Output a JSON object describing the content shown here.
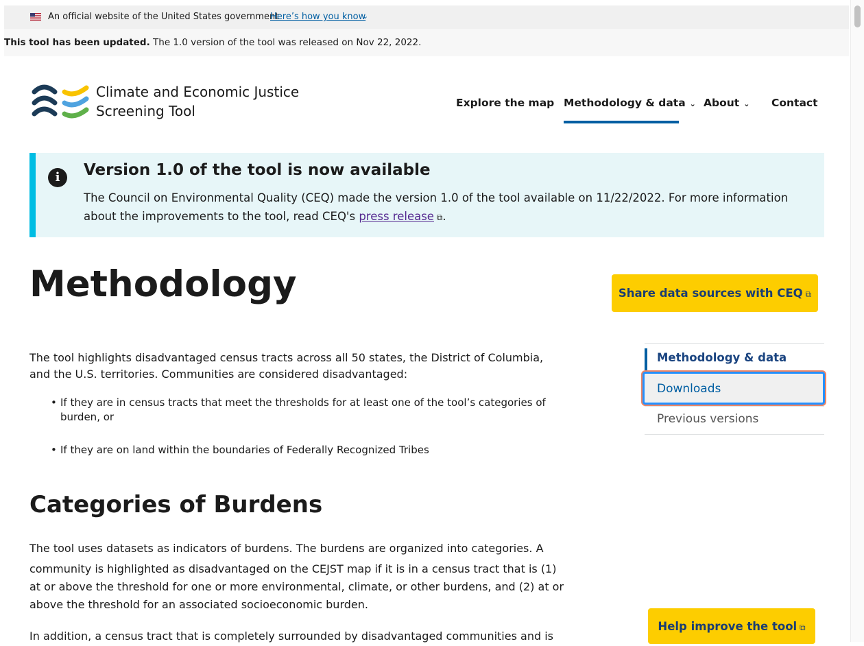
{
  "gov_banner": {
    "text": "An official website of the United States government",
    "link": "Here’s how you know"
  },
  "update_bar": {
    "bold": "This tool has been updated.",
    "text": " The 1.0 version of the tool was released on Nov 22, 2022."
  },
  "header": {
    "title_line1": "Climate and Economic Justice",
    "title_line2": "Screening Tool",
    "nav": {
      "explore": "Explore the map",
      "methodology": "Methodology & data",
      "about": "About",
      "contact": "Contact"
    }
  },
  "alert": {
    "heading": "Version 1.0 of the tool is now available",
    "body_before": "The Council on Environmental Quality (CEQ) made the version 1.0 of the tool available on 11/22/2022. For more information about the improvements to the tool, read CEQ's ",
    "link": "press release",
    "body_after": "."
  },
  "main": {
    "title": "Methodology",
    "intro_line1": "The tool highlights disadvantaged census tracts across all 50 states, the District of Columbia,",
    "intro_line2": "and the U.S. territories. Communities are considered disadvantaged:",
    "bullet1_line1": "If they are in census tracts that meet the thresholds for at least one of the tool’s categories of",
    "bullet1_line2": "burden, or",
    "bullet2": "If they are on land within the boundaries of Federally Recognized Tribes",
    "categories_heading": "Categories of Burdens",
    "cat_p1_l1": "The tool uses datasets as indicators of burdens. The burdens are organized into categories. A",
    "cat_p1_l2": "community is highlighted as disadvantaged on the CEJST map if it is in a census tract that is (1)",
    "cat_p1_l3": "at or above the threshold for one or more environmental, climate, or other burdens, and (2) at or",
    "cat_p1_l4": "above the threshold for an associated socioeconomic burden.",
    "cat_p2_l1": "In addition, a census tract that is completely surrounded by disadvantaged communities and is"
  },
  "share_button": "Share data sources with CEQ",
  "side_nav": {
    "item1": "Methodology & data",
    "item2": "Downloads",
    "item3": "Previous versions"
  },
  "help_button": "Help improve the tool",
  "colors": {
    "primary": "#005ea2",
    "accent_yellow": "#fdcd00",
    "alert_bg": "#e7f6f8",
    "alert_border": "#00bde3"
  }
}
